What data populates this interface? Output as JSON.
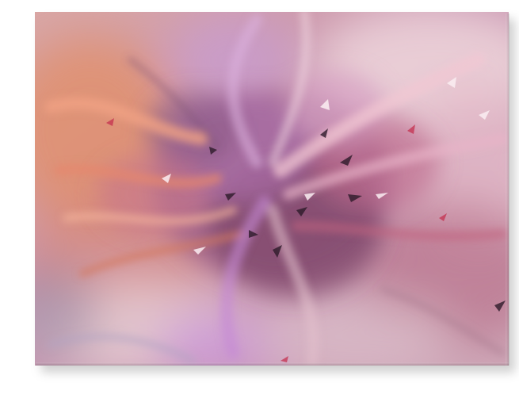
{
  "artwork": {
    "subject": "abstract-floral-burst-canvas",
    "palette": {
      "blush": "#e9c2c4",
      "peach": "#e2957c",
      "coral": "#d8796a",
      "rose": "#b7607e",
      "magenta": "#a14d93",
      "lilac": "#c69fd0",
      "plum": "#5c3552",
      "ink": "#2e1b2a",
      "mist": "#ead9df"
    }
  }
}
